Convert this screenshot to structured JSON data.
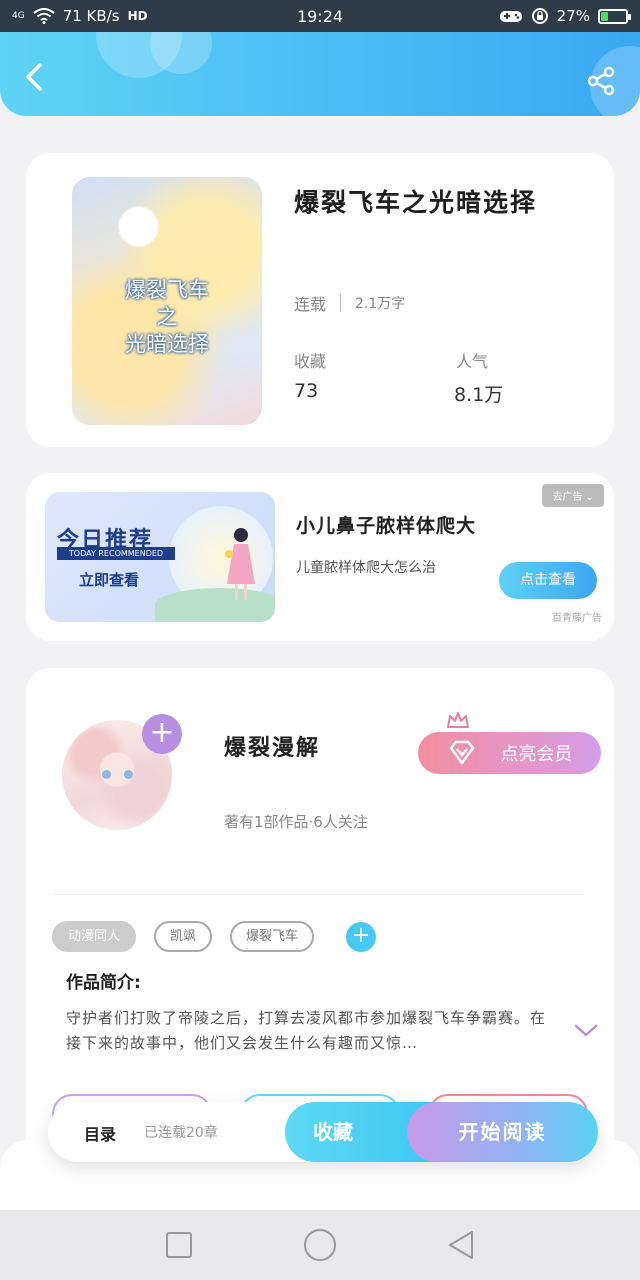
{
  "status_bar": {
    "network": "4G",
    "speed": "71 KB/s",
    "hd": "HD",
    "time": "19:24",
    "battery_text": "27%",
    "battery_level": 0.27
  },
  "header": {
    "back_icon": "chevron-left-icon",
    "share_icon": "share-icon"
  },
  "book": {
    "cover_title_lines": [
      "爆裂飞车",
      "之",
      "光暗选择"
    ],
    "title": "爆裂飞车之光暗选择",
    "status": "连载",
    "word_count": "2.1万字",
    "favorites_label": "收藏",
    "favorites_value": "73",
    "popularity_label": "人气",
    "popularity_value": "8.1万"
  },
  "ad": {
    "image_title": "今日推荐",
    "image_subtitle": "TODAY RECOMMENDED",
    "image_cta": "立即查看",
    "close_label": "去广告",
    "title": "小儿鼻子脓样体爬大",
    "description": "儿童脓样体爬大怎么治",
    "button_label": "点击查看",
    "source": "百青藤广告"
  },
  "author": {
    "name": "爆裂漫解",
    "meta": "著有1部作品·6人关注",
    "follow_icon": "plus-icon",
    "vip_label": "点亮会员",
    "tags": [
      "动漫同人",
      "凯飒",
      "爆裂飞车"
    ],
    "intro_label": "作品简介:",
    "intro_text": "守护者们打败了帝陵之后，打算去凌风都市参加爆裂飞车争霸赛。在接下来的故事中，他们又会发生什么有趣而又惊…"
  },
  "action_bar": {
    "toc_label": "目录",
    "chapter_count": "已连载20章",
    "favorite_label": "收藏",
    "read_label": "开始阅读"
  },
  "nav": {
    "recent_icon": "square-icon",
    "home_icon": "circle-icon",
    "back_icon": "triangle-back-icon"
  },
  "colors": {
    "header_start": "#5fd3f5",
    "header_end": "#3aa8f2",
    "accent_blue": "#48c8f2",
    "accent_purple": "#b78ee0",
    "vip_pink": "#f48da0"
  }
}
